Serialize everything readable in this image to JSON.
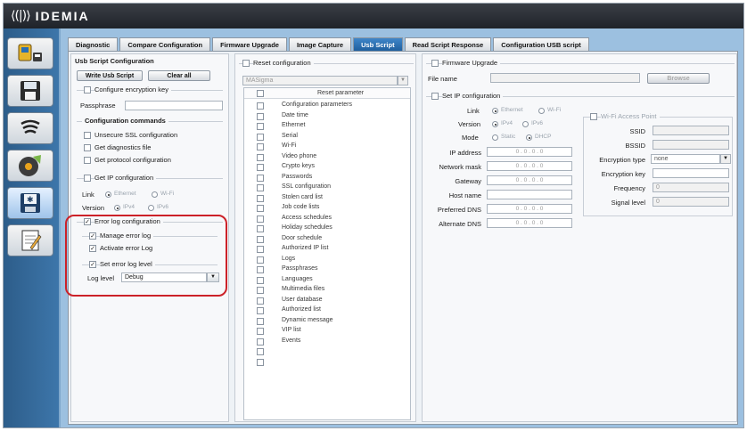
{
  "app": {
    "brand": "IDEMIA"
  },
  "tabs": [
    {
      "label": "Diagnostic",
      "active": false
    },
    {
      "label": "Compare Configuration",
      "active": false
    },
    {
      "label": "Firmware Upgrade",
      "active": false
    },
    {
      "label": "Image Capture",
      "active": false
    },
    {
      "label": "Usb Script",
      "active": true
    },
    {
      "label": "Read Script Response",
      "active": false
    },
    {
      "label": "Configuration USB script",
      "active": false
    }
  ],
  "usb_script": {
    "title": "Usb Script Configuration",
    "write_button": "Write Usb Script",
    "clear_button": "Clear all",
    "encryption": {
      "label": "Configure encryption key",
      "passphrase_label": "Passphrase",
      "passphrase_value": ""
    },
    "config_commands": {
      "title": "Configuration commands",
      "items": [
        "Unsecure SSL configuration",
        "Get diagnostics file",
        "Get protocol configuration"
      ]
    },
    "ip_config": {
      "label": "Get IP configuration",
      "link_label": "Link",
      "link_options": [
        "Ethernet",
        "Wi-Fi"
      ],
      "version_label": "Version",
      "version_options": [
        "IPv4",
        "IPv6"
      ]
    },
    "error_log": {
      "label": "Error log configuration",
      "manage": "Manage error log",
      "activate": "Activate error Log",
      "set_level": "Set error log level",
      "level_label": "Log level",
      "level_value": "Debug"
    }
  },
  "reset": {
    "label": "Reset configuration",
    "dropdown_value": "MASigma",
    "header": "Reset parameter",
    "items": [
      "Configuration parameters",
      "Date time",
      "Ethernet",
      "Serial",
      "Wi-Fi",
      "Video phone",
      "Crypto keys",
      "Passwords",
      "SSL configuration",
      "Stolen card list",
      "Job code lists",
      "Access schedules",
      "Holiday schedules",
      "Door schedule",
      "Authorized IP list",
      "Logs",
      "Passphrases",
      "Languages",
      "Multimedia files",
      "User database",
      "Authorized list",
      "Dynamic message",
      "VIP list",
      "Events"
    ],
    "empty_rows": 2
  },
  "firmware": {
    "label": "Firmware Upgrade",
    "file_label": "File name",
    "browse_label": "Browse"
  },
  "set_ip": {
    "label": "Set IP configuration",
    "link_label": "Link",
    "link_options": [
      "Ethernet",
      "Wi-Fi"
    ],
    "version_label": "Version",
    "version_options": [
      "IPv4",
      "IPv6"
    ],
    "mode_label": "Mode",
    "mode_options": [
      "Static",
      "DHCP"
    ],
    "fields": [
      "IP address",
      "Network mask",
      "Gateway",
      "Host name",
      "Preferred DNS",
      "Alternate DNS"
    ],
    "ip_placeholder": "0 . 0 . 0 . 0"
  },
  "wifi": {
    "label": "Wi-Fi Access Point",
    "ssid": "SSID",
    "bssid": "BSSID",
    "encryption_label": "Encryption type",
    "encryption_value": "none",
    "key_label": "Encryption key",
    "frequency_label": "Frequency",
    "frequency_value": "0",
    "signal_label": "Signal level",
    "signal_value": "0"
  },
  "colors": {
    "accent": "#2a6fb3",
    "highlight": "#cc2128"
  }
}
